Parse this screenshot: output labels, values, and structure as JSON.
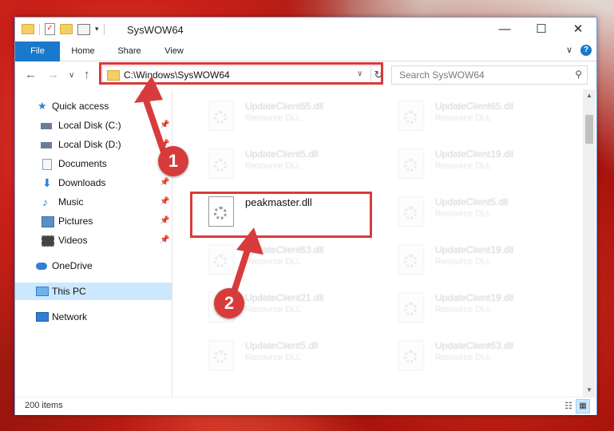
{
  "window": {
    "title": "SysWOW64",
    "minimize": "—",
    "maximize": "☐",
    "close": "✕"
  },
  "ribbon": {
    "tabs": [
      "File",
      "Home",
      "Share",
      "View"
    ],
    "collapse": "∨",
    "help": "?"
  },
  "addressbar": {
    "back": "←",
    "forward": "→",
    "recent": "∨",
    "up": "↑",
    "path": "C:\\Windows\\SysWOW64",
    "dropdown": "∨",
    "refresh": "↻",
    "search_placeholder": "Search SysWOW64",
    "search_icon": "⚲"
  },
  "sidebar": {
    "items": [
      {
        "label": "Quick access",
        "icon": "star-icon",
        "color": "#2f7fd6",
        "pinned": false
      },
      {
        "label": "Local Disk (C:)",
        "icon": "drive-icon",
        "color": "#6b7c93",
        "pinned": true
      },
      {
        "label": "Local Disk (D:)",
        "icon": "drive-icon",
        "color": "#6b7c93",
        "pinned": true
      },
      {
        "label": "Documents",
        "icon": "documents-icon",
        "color": "#8aa0b8",
        "pinned": true
      },
      {
        "label": "Downloads",
        "icon": "downloads-icon",
        "color": "#2f7fd6",
        "pinned": true
      },
      {
        "label": "Music",
        "icon": "music-icon",
        "color": "#2f7fd6",
        "pinned": true
      },
      {
        "label": "Pictures",
        "icon": "pictures-icon",
        "color": "#5a8fc7",
        "pinned": true
      },
      {
        "label": "Videos",
        "icon": "videos-icon",
        "color": "#444444",
        "pinned": true
      },
      {
        "label": "OneDrive",
        "icon": "cloud-icon",
        "color": "#2f7fd6",
        "pinned": false
      },
      {
        "label": "This PC",
        "icon": "computer-icon",
        "color": "#2f7fd6",
        "pinned": false,
        "selected": true
      },
      {
        "label": "Network",
        "icon": "network-icon",
        "color": "#2f7fd6",
        "pinned": false
      }
    ],
    "pin_glyph": "📌"
  },
  "files": {
    "left": [
      {
        "name": "UpdateClient65.dll",
        "type": "Resource DLL"
      },
      {
        "name": "UpdateClient5.dll",
        "type": "Resource DLL"
      },
      {
        "name": "peakmaster.dll",
        "type": ""
      },
      {
        "name": "UpdateClient63.dll",
        "type": "Resource DLL"
      },
      {
        "name": "UpdateClient21.dll",
        "type": "Resource DLL"
      },
      {
        "name": "UpdateClient5.dll",
        "type": "Resource DLL"
      }
    ],
    "right": [
      {
        "name": "UpdateClient65.dll",
        "type": "Resource DLL"
      },
      {
        "name": "UpdateClient19.dll",
        "type": "Resource DLL"
      },
      {
        "name": "UpdateClient5.dll",
        "type": "Resource DLL"
      },
      {
        "name": "UpdateClient19.dll",
        "type": "Resource DLL"
      },
      {
        "name": "UpdateClient19.dll",
        "type": "Resource DLL"
      },
      {
        "name": "UpdateClient63.dll",
        "type": "Resource DLL"
      }
    ]
  },
  "status": {
    "count": "200 items",
    "details_view": "☷",
    "icons_view": "▦"
  },
  "annotations": {
    "step1": "1",
    "step2": "2",
    "color": "#d83b3b"
  }
}
